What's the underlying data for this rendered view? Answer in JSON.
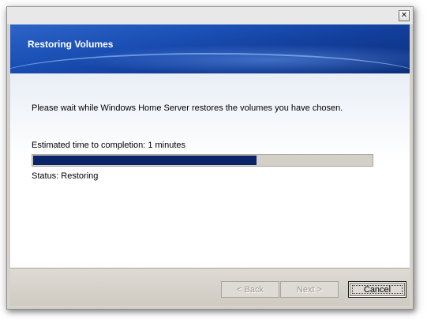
{
  "window": {
    "close_glyph": "✕",
    "header": {
      "title": "Restoring Volumes"
    },
    "body": {
      "message": "Please wait while Windows Home Server restores the volumes you have chosen.",
      "estimated_time": "Estimated time to completion: 1 minutes",
      "progress_fraction": 0.66,
      "status": "Status: Restoring"
    },
    "buttons": {
      "back": "< Back",
      "next": "Next >",
      "cancel": "Cancel"
    }
  },
  "colors": {
    "banner": "#1a4fb4",
    "progress_fill": "#0a246a"
  }
}
